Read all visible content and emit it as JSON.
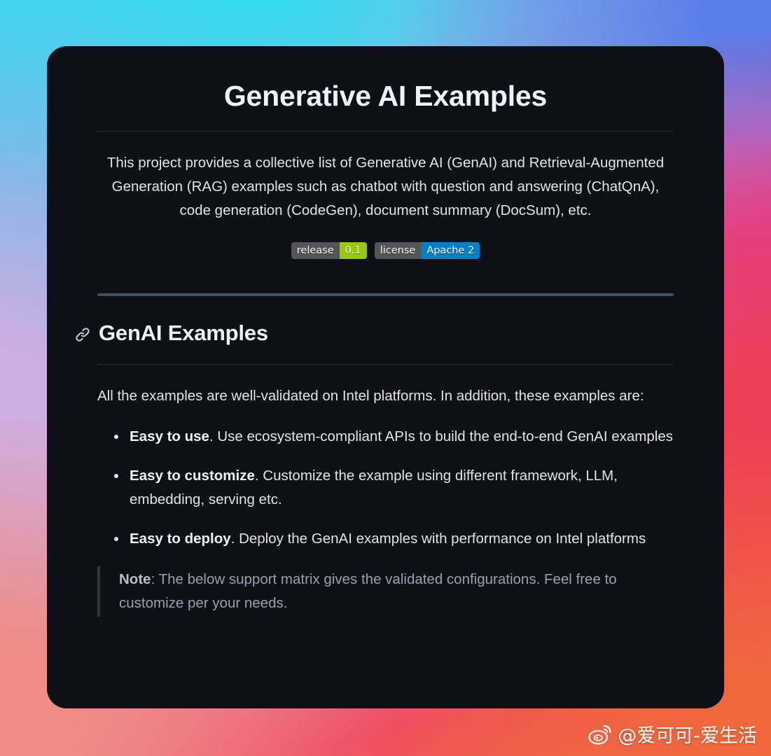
{
  "background": {
    "corner_top_left": "#2fdcef",
    "corner_top_right": "#5b7fe8",
    "mid_left": "#ceaee2",
    "mid_right": "#dc3f9c",
    "corner_bottom_left": "#ef8d86",
    "corner_bottom_right": "#f06a3d"
  },
  "card": {
    "background": "#0d1117",
    "title": "Generative AI Examples",
    "intro": "This project provides a collective list of Generative AI (GenAI) and Retrieval-Augmented Generation (RAG) examples such as chatbot with question and answering (ChatQnA), code generation (CodeGen), document summary (DocSum), etc.",
    "badges": [
      {
        "name": "release-badge",
        "label": "release",
        "value": "0.1",
        "label_color": "#555555",
        "value_color": "#97ca00"
      },
      {
        "name": "license-badge",
        "label": "license",
        "value": "Apache 2",
        "label_color": "#555555",
        "value_color": "#007ec6"
      }
    ],
    "section": {
      "anchor_icon": "link-icon",
      "heading": "GenAI Examples",
      "lead": "All the examples are well-validated on Intel platforms. In addition, these examples are:",
      "bullets": [
        {
          "term": "Easy to use",
          "text": ". Use ecosystem-compliant APIs to build the end-to-end GenAI examples"
        },
        {
          "term": "Easy to customize",
          "text": ". Customize the example using different framework, LLM, embedding, serving etc."
        },
        {
          "term": "Easy to deploy",
          "text": ". Deploy the GenAI examples with performance on Intel platforms"
        }
      ],
      "note": {
        "term": "Note",
        "text": ": The below support matrix gives the validated configurations. Feel free to customize per your needs."
      }
    }
  },
  "watermark": {
    "icon": "weibo-icon",
    "handle": "@爱可可-爱生活"
  }
}
